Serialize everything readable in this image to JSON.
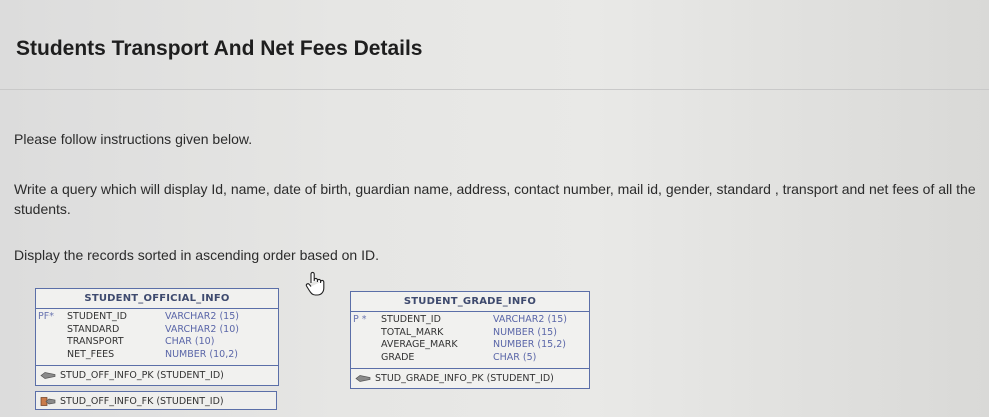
{
  "page": {
    "title": "Students Transport And Net Fees Details",
    "instruction_1": "Please follow instructions given below.",
    "instruction_2": "Write a query which will display Id, name, date of birth, guardian name, address, contact number, mail id, gender, standard , transport and net fees of all the students.",
    "instruction_3": "Display the records sorted in ascending order based on ID."
  },
  "tables": {
    "student_official_info": {
      "name": "STUDENT_OFFICIAL_INFO",
      "columns": [
        {
          "key": "PF*",
          "name": "STUDENT_ID",
          "type": "VARCHAR2 (15)"
        },
        {
          "key": "",
          "name": "STANDARD",
          "type": "VARCHAR2 (10)"
        },
        {
          "key": "",
          "name": "TRANSPORT",
          "type": "CHAR (10)"
        },
        {
          "key": "",
          "name": "NET_FEES",
          "type": "NUMBER (10,2)"
        }
      ],
      "pk": "STUD_OFF_INFO_PK (STUDENT_ID)",
      "fk": "STUD_OFF_INFO_FK (STUDENT_ID)"
    },
    "student_grade_info": {
      "name": "STUDENT_GRADE_INFO",
      "columns": [
        {
          "key": "P *",
          "name": "STUDENT_ID",
          "type": "VARCHAR2 (15)"
        },
        {
          "key": "",
          "name": "TOTAL_MARK",
          "type": "NUMBER (15)"
        },
        {
          "key": "",
          "name": "AVERAGE_MARK",
          "type": "NUMBER (15,2)"
        },
        {
          "key": "",
          "name": "GRADE",
          "type": "CHAR (5)"
        }
      ],
      "pk": "STUD_GRADE_INFO_PK (STUDENT_ID)"
    }
  },
  "colors": {
    "border": "#5b6fa8",
    "type_text": "#5a66a8"
  }
}
